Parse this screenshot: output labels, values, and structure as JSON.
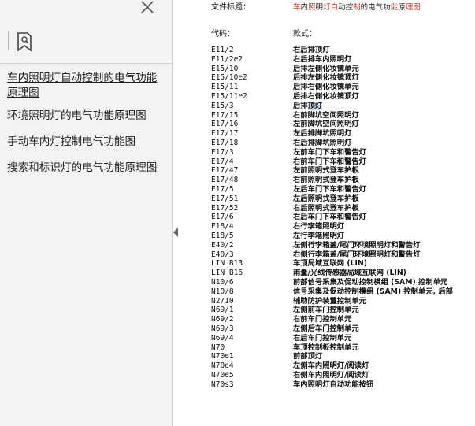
{
  "sidebar": {
    "bookmarks": [
      {
        "label": "车内照明灯自动控制的电气功能原理图",
        "active": true
      },
      {
        "label": "环境照明灯的电气功能原理图",
        "active": false
      },
      {
        "label": "手动车内灯控制电气功能图",
        "active": false
      },
      {
        "label": "搜索和标识灯的电气功能原理图",
        "active": false
      }
    ]
  },
  "document": {
    "file_title_label": "文件标题：",
    "file_title_value": "车内照明灯自动控制的电气功能原理图",
    "code_header": "代码：",
    "name_header": "款式：",
    "rows": [
      {
        "code": "E11/2",
        "name": "右后排顶灯"
      },
      {
        "code": "E11/2e2",
        "name": "右后排车内照明灯"
      },
      {
        "code": "E15/10",
        "name": "后排左侧化妆镜单元"
      },
      {
        "code": "E15/10e2",
        "name": "后排左侧化妆镜顶灯"
      },
      {
        "code": "E15/11",
        "name": "后排右侧化妆镜单元"
      },
      {
        "code": "E15/11e2",
        "name": "后排右侧化妆镜顶灯"
      },
      {
        "code": "E15/3",
        "name": "后排顶灯"
      },
      {
        "code": "E17/15",
        "name": "右前脚坑空间照明灯"
      },
      {
        "code": "E17/16",
        "name": "左前脚坑空间照明灯"
      },
      {
        "code": "E17/17",
        "name": "左后排脚坑照明灯"
      },
      {
        "code": "E17/18",
        "name": "右后排脚坑照明灯"
      },
      {
        "code": "E17/3",
        "name": "左前车门下车和警告灯"
      },
      {
        "code": "E17/4",
        "name": "右前车门下车和警告灯"
      },
      {
        "code": "E17/47",
        "name": "左前照明式登车护板"
      },
      {
        "code": "E17/48",
        "name": "右前照明式登车护板"
      },
      {
        "code": "E17/5",
        "name": "左后车门下车和警告灯"
      },
      {
        "code": "E17/51",
        "name": "左后照明式登车护板"
      },
      {
        "code": "E17/52",
        "name": "右后照明式登车护板"
      },
      {
        "code": "E17/6",
        "name": "右后车门下车和警告灯"
      },
      {
        "code": "E18/4",
        "name": "右行李箱照明灯"
      },
      {
        "code": "E18/5",
        "name": "左行李箱照明灯"
      },
      {
        "code": "E40/2",
        "name": "左侧行李箱盖/尾门环境照明灯和警告灯"
      },
      {
        "code": "E40/3",
        "name": "右侧行李箱盖/尾门环境照明灯和警告灯"
      },
      {
        "code": "LIN B13",
        "name": "车顶局域互联网 (LIN)"
      },
      {
        "code": "LIN B16",
        "name": "雨量/光线传感器局域互联网 (LIN)"
      },
      {
        "code": "N10/6",
        "name": "前部信号采集及促动控制模组 (SAM) 控制单元"
      },
      {
        "code": "N10/8",
        "name": "信号采集及促动控制模组 (SAM) 控制单元, 后部"
      },
      {
        "code": "N2/10",
        "name": "辅助防护装置控制单元"
      },
      {
        "code": "N69/1",
        "name": "左侧前车门控制单元"
      },
      {
        "code": "N69/2",
        "name": "右前车门控制单元"
      },
      {
        "code": "N69/3",
        "name": "左侧后车门控制单元"
      },
      {
        "code": "N69/4",
        "name": "右后车门控制单元"
      },
      {
        "code": "N70",
        "name": "车顶控制板控制单元"
      },
      {
        "code": "N70e1",
        "name": "前部顶灯"
      },
      {
        "code": "N70e4",
        "name": "左侧车内照明灯/阅读灯"
      },
      {
        "code": "N70e5",
        "name": "右侧车内照明灯/阅读灯"
      },
      {
        "code": "N70s3",
        "name": "车内照明灯自动功能按钮"
      }
    ]
  },
  "colors": {
    "accent_red": "#c0392b",
    "highlight": "#cfe0f5"
  }
}
